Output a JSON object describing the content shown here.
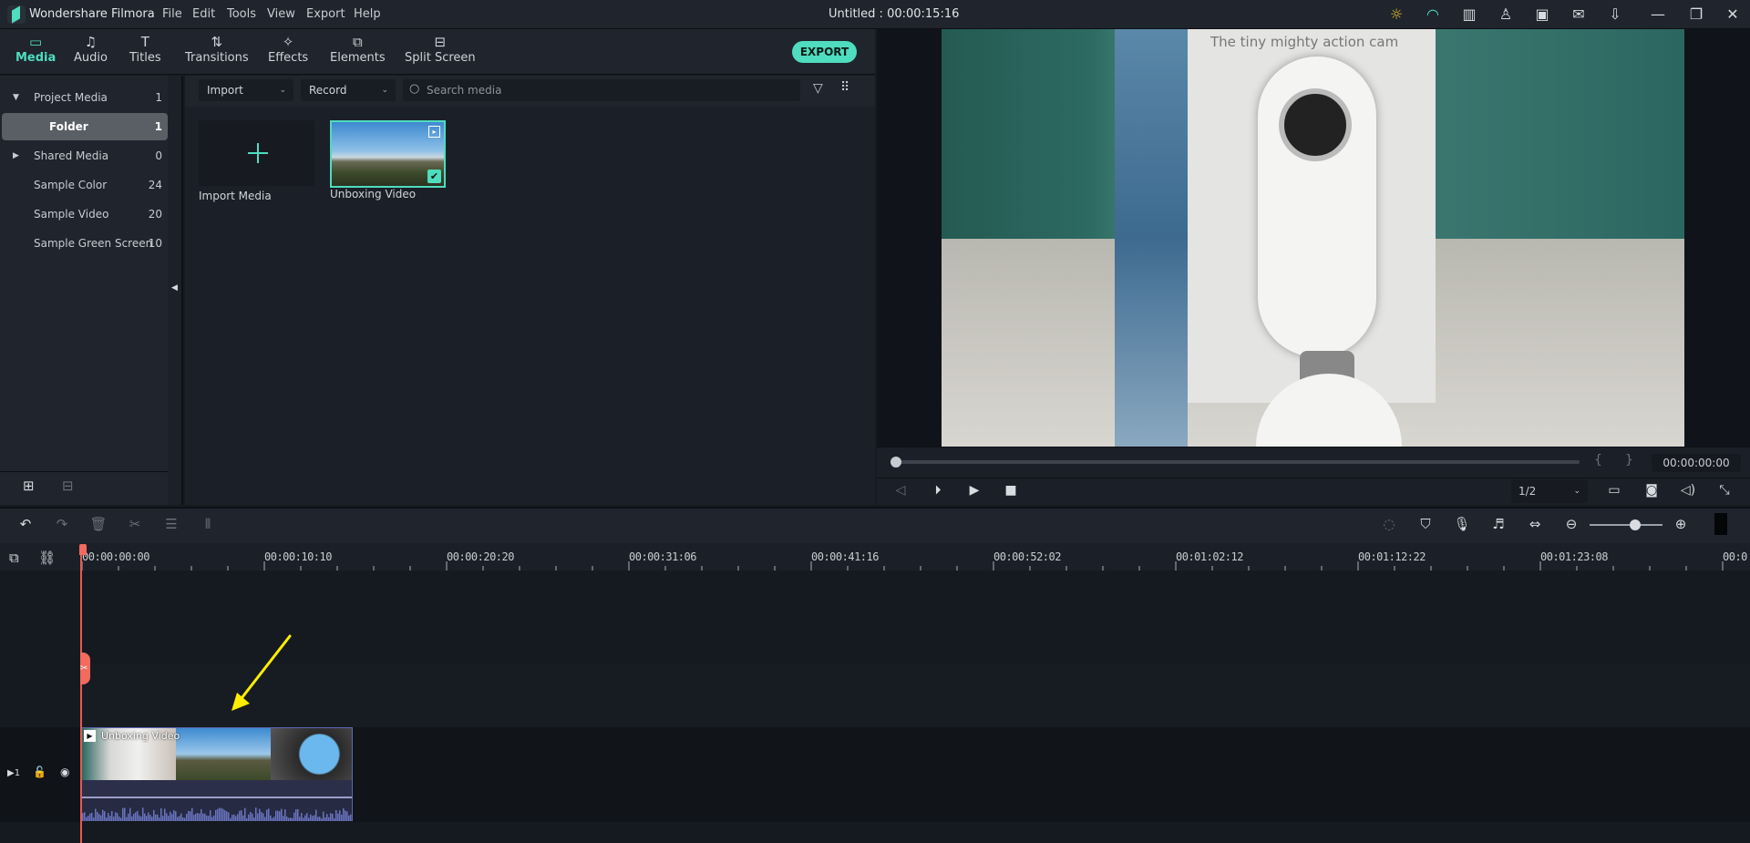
{
  "app": {
    "name": "Wondershare Filmora",
    "doc_title": "Untitled : 00:00:15:16"
  },
  "menu": [
    "File",
    "Edit",
    "Tools",
    "View",
    "Export",
    "Help"
  ],
  "title_icons": [
    "lightbulb-icon",
    "headset-icon",
    "gift-icon",
    "account-icon",
    "save-icon",
    "mail-icon",
    "download-icon",
    "minimize-icon",
    "restore-icon",
    "close-icon"
  ],
  "nav_tabs": [
    {
      "label": "Media",
      "icon": "folder-icon",
      "active": true
    },
    {
      "label": "Audio",
      "icon": "music-note-icon"
    },
    {
      "label": "Titles",
      "icon": "text-icon"
    },
    {
      "label": "Transitions",
      "icon": "transitions-icon"
    },
    {
      "label": "Effects",
      "icon": "effects-icon"
    },
    {
      "label": "Elements",
      "icon": "elements-icon"
    },
    {
      "label": "Split Screen",
      "icon": "split-screen-icon"
    }
  ],
  "export_label": "EXPORT",
  "sidebar": {
    "items": [
      {
        "label": "Project Media",
        "count": "1",
        "expanded": true
      },
      {
        "label": "Folder",
        "count": "1",
        "selected": true
      },
      {
        "label": "Shared Media",
        "count": "0",
        "expanded": false
      },
      {
        "label": "Sample Color",
        "count": "24"
      },
      {
        "label": "Sample Video",
        "count": "20"
      },
      {
        "label": "Sample Green Screen",
        "count": "10"
      }
    ]
  },
  "media_toolbar": {
    "import": "Import",
    "record": "Record",
    "search_placeholder": "Search media"
  },
  "media_items": [
    {
      "label": "Import Media"
    },
    {
      "label": "Unboxing Video",
      "selected": true
    }
  ],
  "preview": {
    "caption": "The tiny mighty action cam",
    "timecode": "00:00:00:00",
    "ratio": "1/2",
    "progress": 0
  },
  "timeline": {
    "ruler_labels": [
      "00:00:00:00",
      "00:00:10:10",
      "00:00:20:20",
      "00:00:31:06",
      "00:00:41:16",
      "00:00:52:02",
      "00:01:02:12",
      "00:01:12:22",
      "00:01:23:08",
      "00:0"
    ],
    "track_number": "1",
    "clip_title": "Unboxing Video",
    "zoom_level": 0.6
  },
  "colors": {
    "accent": "#4fdcbf",
    "playhead": "#f36a5e",
    "annotation_arrow": "#ffee00"
  }
}
